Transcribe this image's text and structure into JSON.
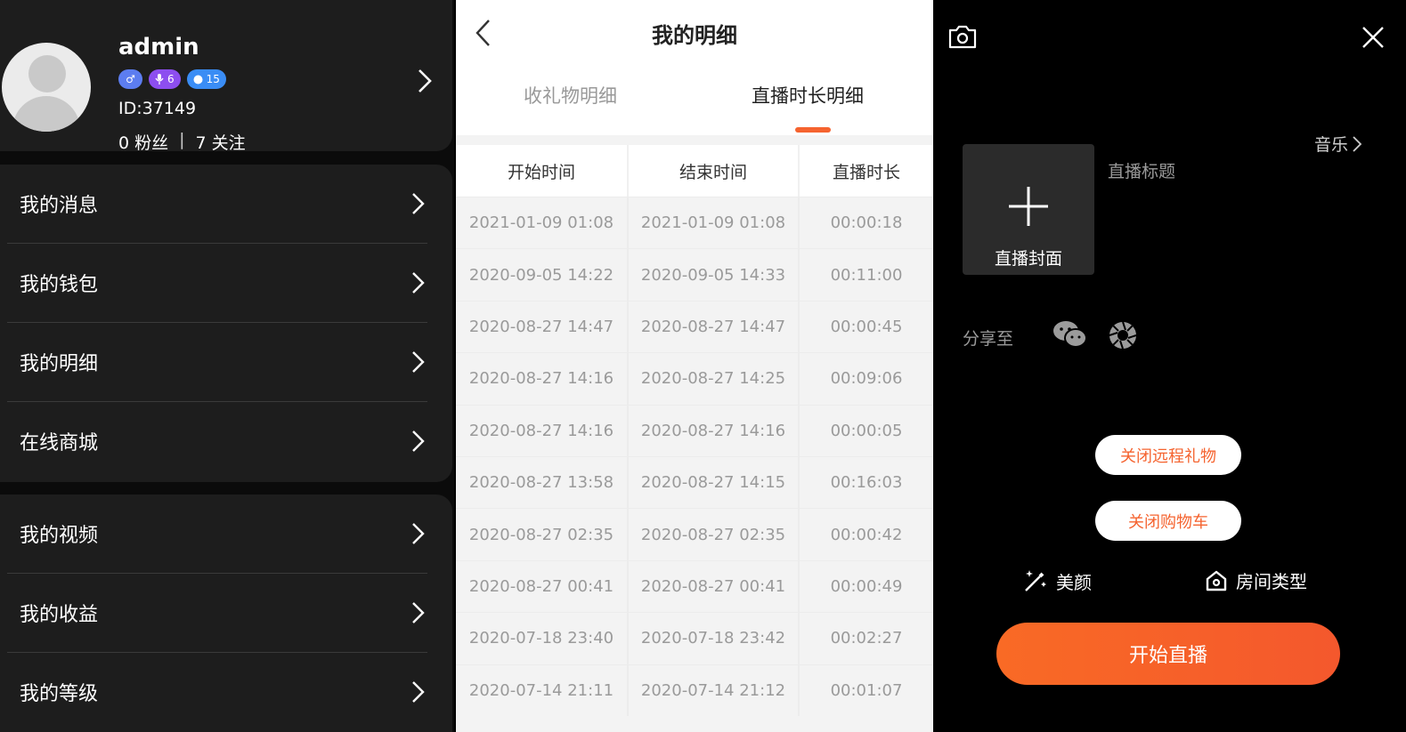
{
  "profile": {
    "username": "admin",
    "badges": {
      "gender": "♂",
      "anchor_level": "6",
      "user_level": "15"
    },
    "id_text": "ID:37149",
    "fans_text": "0 粉丝",
    "separator": "|",
    "follow_text": "7 关注"
  },
  "menu": {
    "group1": [
      "我的消息",
      "我的钱包",
      "我的明细",
      "在线商城"
    ],
    "group2": [
      "我的视频",
      "我的收益",
      "我的等级"
    ]
  },
  "detail": {
    "title": "我的明细",
    "tabs": [
      "收礼物明细",
      "直播时长明细"
    ],
    "active_tab": 1,
    "columns": [
      "开始时间",
      "结束时间",
      "直播时长"
    ],
    "rows": [
      [
        "2021-01-09 01:08",
        "2021-01-09 01:08",
        "00:00:18"
      ],
      [
        "2020-09-05 14:22",
        "2020-09-05 14:33",
        "00:11:00"
      ],
      [
        "2020-08-27 14:47",
        "2020-08-27 14:47",
        "00:00:45"
      ],
      [
        "2020-08-27 14:16",
        "2020-08-27 14:25",
        "00:09:06"
      ],
      [
        "2020-08-27 14:16",
        "2020-08-27 14:16",
        "00:00:05"
      ],
      [
        "2020-08-27 13:58",
        "2020-08-27 14:15",
        "00:16:03"
      ],
      [
        "2020-08-27 02:35",
        "2020-08-27 02:35",
        "00:00:42"
      ],
      [
        "2020-08-27 00:41",
        "2020-08-27 00:41",
        "00:00:49"
      ],
      [
        "2020-07-18 23:40",
        "2020-07-18 23:42",
        "00:02:27"
      ],
      [
        "2020-07-14 21:11",
        "2020-07-14 21:12",
        "00:01:07"
      ]
    ]
  },
  "live": {
    "music_label": "音乐",
    "cover_label": "直播封面",
    "title_placeholder": "直播标题",
    "share_label": "分享至",
    "close_gift_label": "关闭远程礼物",
    "close_cart_label": "关闭购物车",
    "beauty_label": "美颜",
    "room_type_label": "房间类型",
    "start_label": "开始直播"
  },
  "colors": {
    "accent": "#f5632f",
    "dark_panel": "#1d1d1d",
    "light_bg": "#f3f3f3"
  },
  "icons": [
    "chevron-right-icon",
    "back-arrow-icon",
    "camera-icon",
    "close-icon",
    "plus-icon",
    "wechat-icon",
    "moments-icon",
    "beauty-wand-icon",
    "room-type-icon"
  ]
}
